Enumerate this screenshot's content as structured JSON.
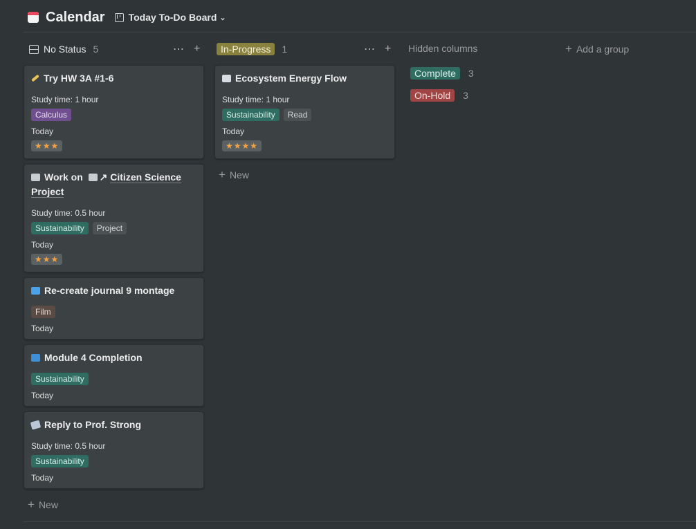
{
  "header": {
    "title": "Calendar",
    "view_name": "Today To-Do Board"
  },
  "columns": [
    {
      "label": "No Status",
      "count": "5",
      "new_label": "New"
    },
    {
      "label": "In-Progress",
      "count": "1",
      "new_label": "New"
    }
  ],
  "cards": {
    "c1": {
      "title": "Try HW 3A #1-6",
      "study": "Study time: 1 hour",
      "tags": [
        "Calculus"
      ],
      "date": "Today",
      "stars": "★★★"
    },
    "c2": {
      "title_prefix": "Work on",
      "title_link": "Citizen Science Project",
      "study": "Study time: 0.5 hour",
      "tags": [
        "Sustainability",
        "Project"
      ],
      "date": "Today",
      "stars": "★★★"
    },
    "c3": {
      "title": "Re-create journal 9 montage",
      "tags": [
        "Film"
      ],
      "date": "Today"
    },
    "c4": {
      "title": "Module 4 Completion",
      "tags": [
        "Sustainability"
      ],
      "date": "Today"
    },
    "c5": {
      "title": "Reply to Prof. Strong",
      "study": "Study time: 0.5 hour",
      "tags": [
        "Sustainability"
      ],
      "date": "Today"
    },
    "c6": {
      "title": "Ecosystem Energy Flow",
      "study": "Study time: 1 hour",
      "tags": [
        "Sustainability",
        "Read"
      ],
      "date": "Today",
      "stars": "★★★★"
    }
  },
  "hidden": {
    "label": "Hidden columns",
    "groups": [
      {
        "label": "Complete",
        "count": "3"
      },
      {
        "label": "On-Hold",
        "count": "3"
      }
    ]
  },
  "add_group_label": "Add a group",
  "colors": {
    "background": "#2f3437",
    "card": "#3c4144",
    "star": "#f4a340"
  }
}
